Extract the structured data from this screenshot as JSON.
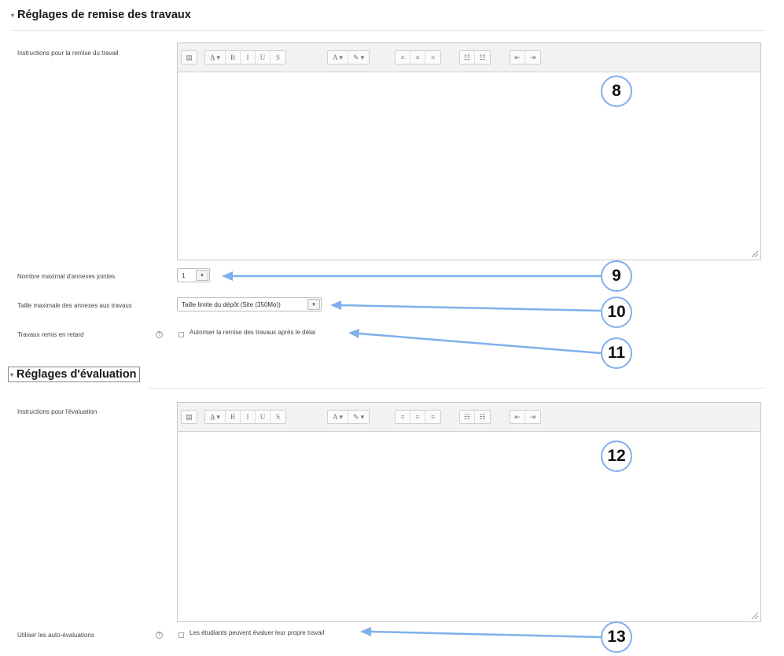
{
  "section_submission": {
    "title": "Réglages de remise des travaux",
    "instructions_label": "Instructions pour la remise du travail",
    "max_files_label": "Nombre maximal d'annexes jointes",
    "max_files_value": "1",
    "max_size_label": "Taille maximale des annexes aux travaux",
    "max_size_value": "Taille limite du dépôt (Site (350Mo))",
    "late_label": "Travaux remis en retard",
    "late_checkbox_label": "Autoriser la remise des travaux après le délai"
  },
  "section_grading": {
    "title": "Réglages d'évaluation",
    "instructions_label": "Instructions pour l'évaluation",
    "self_eval_label": "Utiliser les auto-évaluations",
    "self_eval_checkbox_label": "Les étudiants peuvent évaluer leur propre travail"
  },
  "toolbar_buttons": [
    "▤",
    "A̲ ▾",
    "B",
    "I",
    "U",
    "S",
    "A ▾",
    "✎ ▾",
    "≡",
    "≡",
    "≡",
    "☷",
    "☷",
    "⇤",
    "⇥"
  ],
  "help_glyph": "?",
  "collapse_glyph": "▾",
  "callouts": [
    "8",
    "9",
    "10",
    "11",
    "12",
    "13"
  ],
  "colors": {
    "callout_blue": "#7fb0ea",
    "toolbar_bg": "#f2f2f2"
  }
}
